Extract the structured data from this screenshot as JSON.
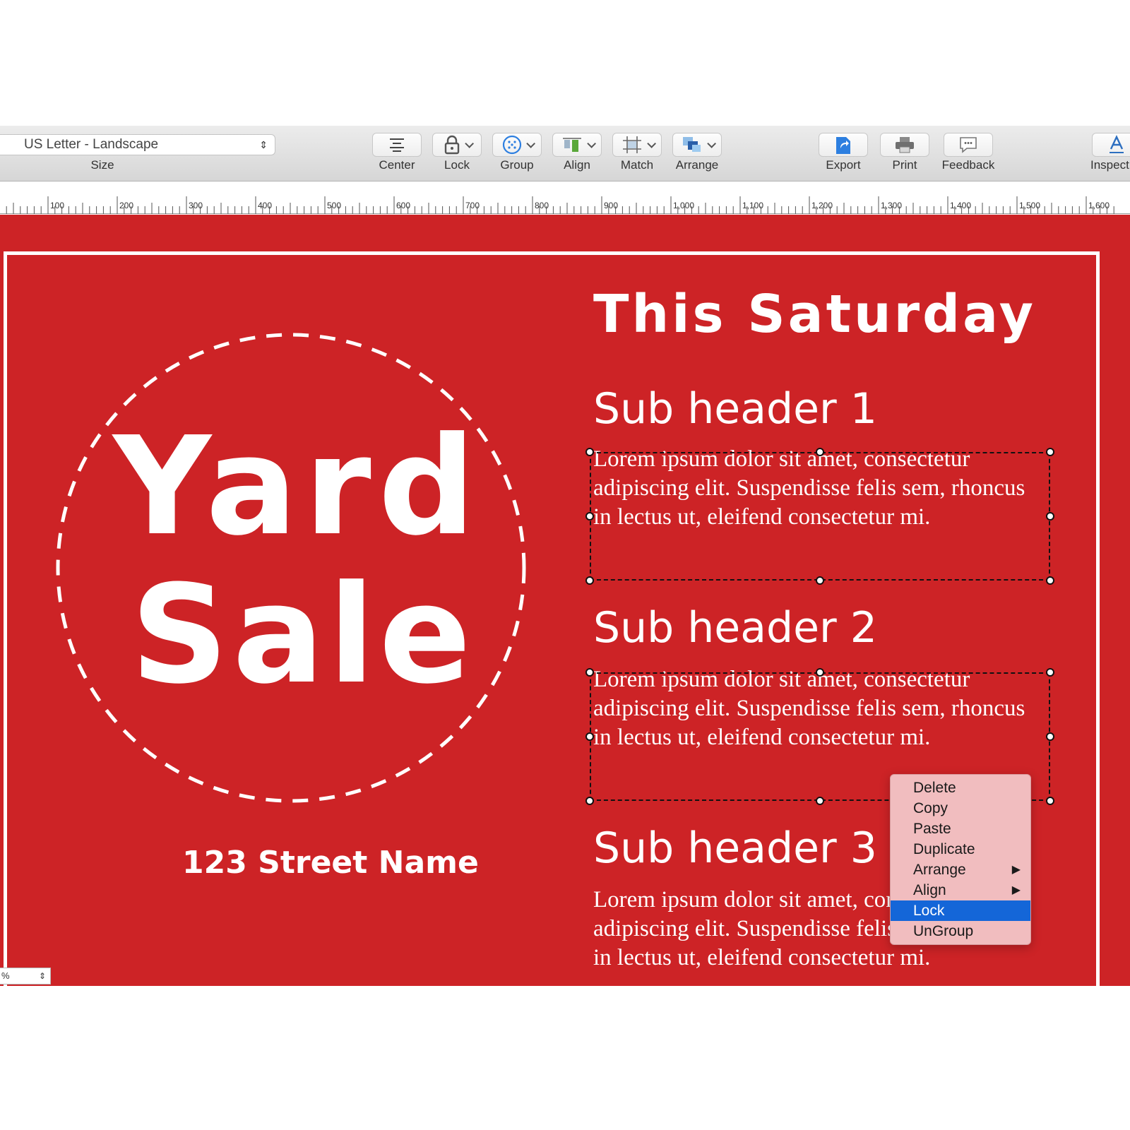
{
  "toolbar": {
    "size_value": "US Letter - Landscape",
    "size_label": "Size",
    "buttons": {
      "center": "Center",
      "lock": "Lock",
      "group": "Group",
      "align": "Align",
      "match": "Match",
      "arrange": "Arrange",
      "export": "Export",
      "print": "Print",
      "feedback": "Feedback",
      "inspector": "Inspect"
    }
  },
  "ruler": {
    "labels": [
      "100",
      "200",
      "300",
      "400",
      "500",
      "600",
      "700",
      "800",
      "900",
      "1,000",
      "1,100",
      "1,200",
      "1,300",
      "1,400",
      "1,500",
      "1,600"
    ]
  },
  "poster": {
    "yard": "Yard",
    "sale": "Sale",
    "street": "123 Street Name",
    "title": "This Saturday",
    "sub1": "Sub header 1",
    "sub2": "Sub header 2",
    "sub3": "Sub header 3",
    "body": "Lorem ipsum dolor sit amet, consectetur adipiscing elit. Suspendisse felis sem, rhoncus in lectus ut, eleifend consectetur mi."
  },
  "zoom": {
    "value": "%"
  },
  "context_menu": {
    "items": [
      {
        "label": "Delete",
        "submenu": false
      },
      {
        "label": "Copy",
        "submenu": false
      },
      {
        "label": "Paste",
        "submenu": false
      },
      {
        "label": "Duplicate",
        "submenu": false
      },
      {
        "label": "Arrange",
        "submenu": true
      },
      {
        "label": "Align",
        "submenu": true
      },
      {
        "label": "Lock",
        "submenu": false
      },
      {
        "label": "UnGroup",
        "submenu": false
      }
    ],
    "highlighted": "Lock",
    "submenu_arrow": "▶"
  },
  "colors": {
    "poster_red": "#cd2326",
    "menu_bg": "#f1bdbf",
    "menu_highlight": "#1466d8",
    "toolbar_bg": "#e2e2e2"
  }
}
